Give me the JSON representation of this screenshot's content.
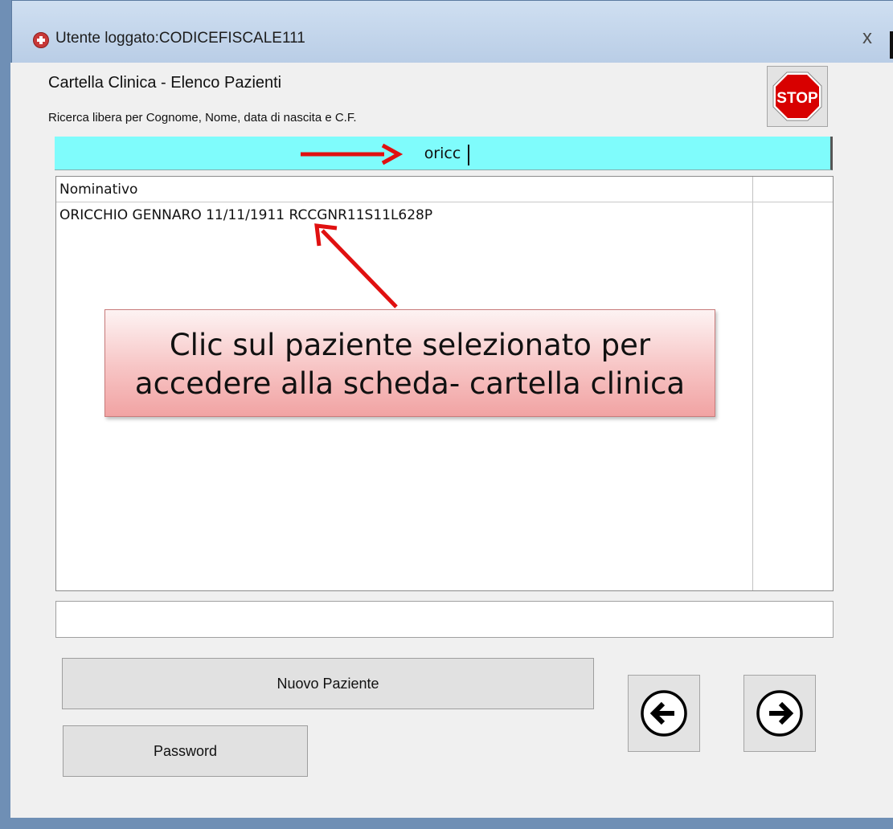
{
  "window": {
    "title": "Utente loggato:CODICEFISCALE111",
    "close_label": "x"
  },
  "header": {
    "title": "Cartella Clinica - Elenco Pazienti",
    "search_hint": "Ricerca libera per Cognome, Nome, data di nascita e C.F."
  },
  "stop_button": {
    "label": "STOP",
    "icon": "stop-sign-icon"
  },
  "search": {
    "value": "oricc",
    "background_color": "#7ffcfc"
  },
  "patient_list": {
    "header": "Nominativo",
    "rows": [
      "ORICCHIO GENNARO 11/11/1911 RCCGNR11S11L628P"
    ]
  },
  "status_field": {
    "value": ""
  },
  "buttons": {
    "new_patient": "Nuovo Paziente",
    "password": "Password",
    "back_icon": "arrow-left-icon",
    "forward_icon": "arrow-right-icon"
  },
  "annotation": {
    "line1": "Clic sul paziente selezionato per",
    "line2": "accedere alla scheda- cartella clinica",
    "arrow_color": "#e01010"
  }
}
